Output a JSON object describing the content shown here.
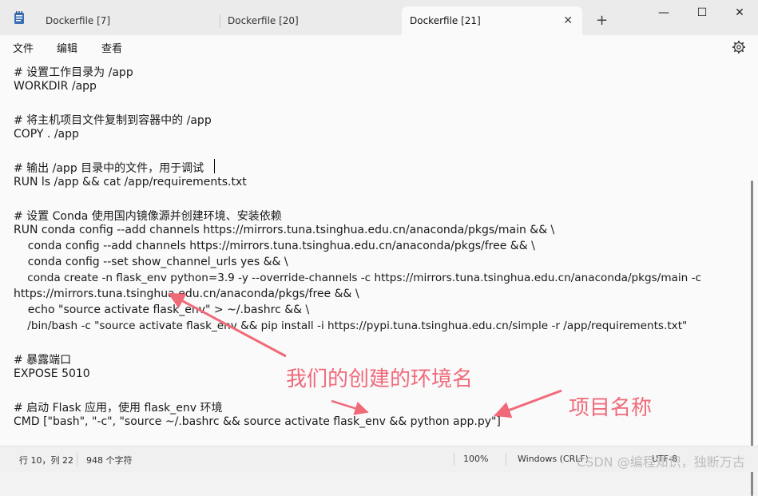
{
  "tabs": [
    {
      "label": "Dockerfile [7]"
    },
    {
      "label": "Dockerfile [20]"
    },
    {
      "label": "Dockerfile [21]",
      "close": "✕"
    }
  ],
  "new_tab": "+",
  "window_controls": {
    "minimize": "—",
    "maximize": "☐",
    "close": "✕"
  },
  "menu": [
    "文件",
    "编辑",
    "查看"
  ],
  "code_lines": [
    "# 设置工作目录为 /app",
    "WORKDIR /app",
    "",
    "# 将主机项目文件复制到容器中的 /app",
    "COPY . /app",
    "",
    "# 输出 /app 目录中的文件，用于调试",
    "RUN ls /app && cat /app/requirements.txt",
    "",
    "# 设置 Conda 使用国内镜像源并创建环境、安装依赖",
    "RUN conda config --add channels https://mirrors.tuna.tsinghua.edu.cn/anaconda/pkgs/main && \\",
    "    conda config --add channels https://mirrors.tuna.tsinghua.edu.cn/anaconda/pkgs/free && \\",
    "    conda config --set show_channel_urls yes && \\",
    "    conda create -n flask_env python=3.9 -y --override-channels -c https://mirrors.tuna.tsinghua.edu.cn/anaconda/pkgs/main -c",
    "https://mirrors.tuna.tsinghua.edu.cn/anaconda/pkgs/free && \\",
    "    echo \"source activate flask_env\" > ~/.bashrc && \\",
    "    /bin/bash -c \"source activate flask_env && pip install -i https://pypi.tuna.tsinghua.edu.cn/simple -r /app/requirements.txt\"",
    "",
    "# 暴露端口",
    "EXPOSE 5010",
    "",
    "# 启动 Flask 应用，使用 flask_env 环境",
    "CMD [\"bash\", \"-c\", \"source ~/.bashrc && source activate flask_env && python app.py\"]"
  ],
  "annotations": {
    "env_name": "我们的创建的环境名",
    "project_name": "项目名称"
  },
  "status": {
    "position": "行 10，列 22",
    "chars": "948 个字符",
    "zoom": "100%",
    "line_ending": "Windows (CRLF)",
    "encoding": "UTF-8"
  },
  "watermark": "CSDN @编程知识，独断万古",
  "colors": {
    "annotation": "#f06a7a",
    "active_tab": "#fafafa",
    "tabbar": "#ebebeb"
  }
}
